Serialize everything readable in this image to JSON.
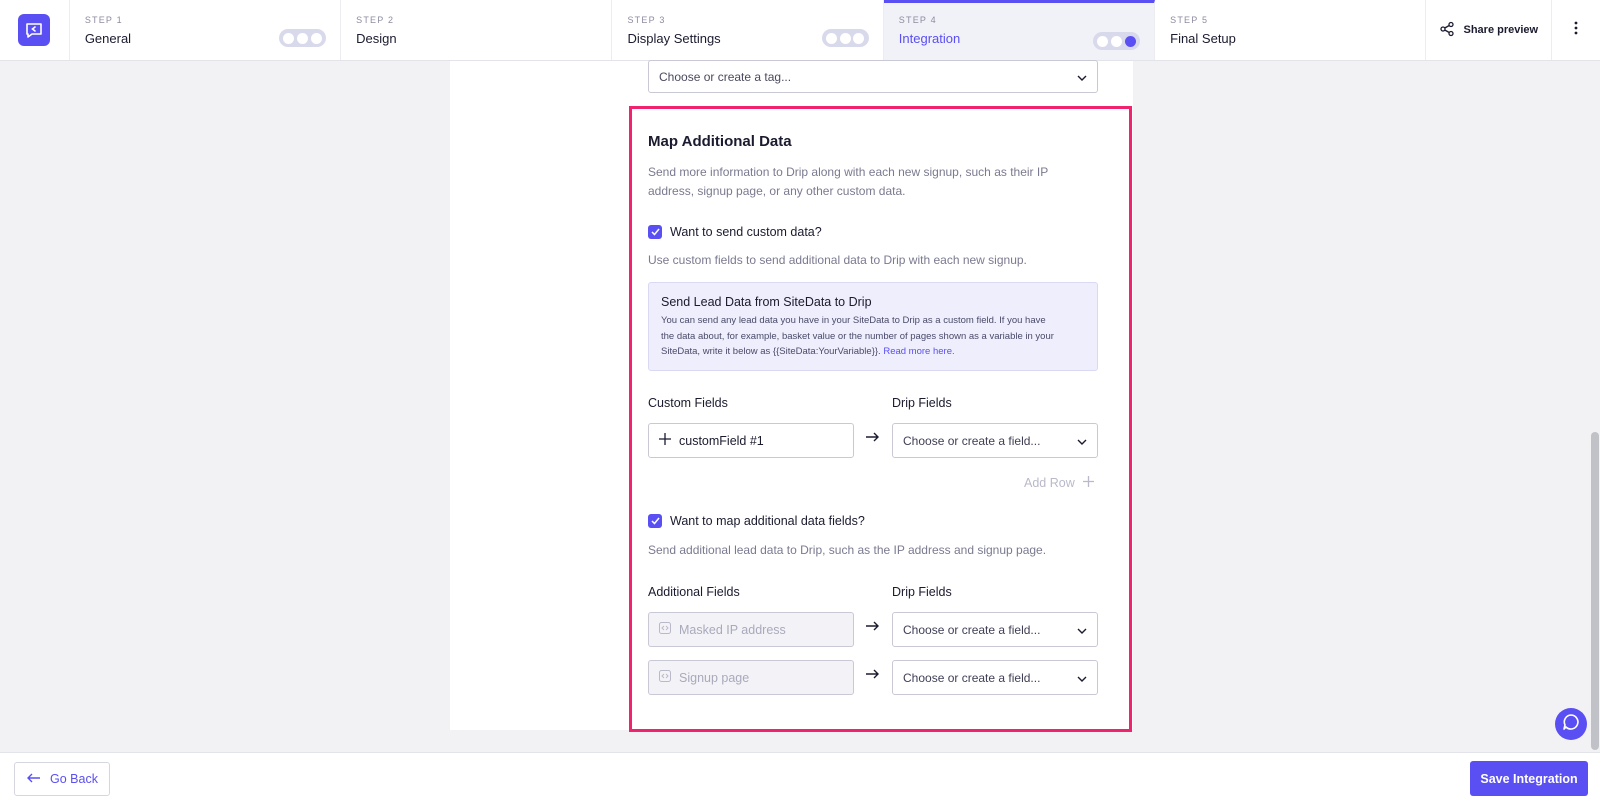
{
  "header": {
    "steps": [
      {
        "num": "STEP 1",
        "name": "General"
      },
      {
        "num": "STEP 2",
        "name": "Design"
      },
      {
        "num": "STEP 3",
        "name": "Display Settings"
      },
      {
        "num": "STEP 4",
        "name": "Integration"
      },
      {
        "num": "STEP 5",
        "name": "Final Setup"
      }
    ],
    "share_label": "Share preview"
  },
  "tag_select": {
    "placeholder": "Choose or create a tag..."
  },
  "map_section": {
    "title": "Map Additional Data",
    "description_line1": "Send more information to Drip along with each new signup, such as their IP",
    "description_line2": "address, signup page, or any other custom data.",
    "custom_checkbox_label": "Want to send custom data?",
    "custom_help": "Use custom fields to send additional data to Drip with each new signup.",
    "info_title": "Send Lead Data from SiteData to Drip",
    "info_line1": "You can send any lead data you have in your SiteData to Drip as a custom field. If you have",
    "info_line2": "the data about, for example, basket value or the number of pages shown as a variable in your",
    "info_line3": "SiteData, write it below as {{SiteData:YourVariable}}.",
    "info_link": "Read more here.",
    "custom_fields_label": "Custom Fields",
    "drip_fields_label": "Drip Fields",
    "custom_field_value": "customField #1",
    "drip_select_placeholder": "Choose or create a field...",
    "add_row_label": "Add Row",
    "additional_checkbox_label": "Want to map additional data fields?",
    "additional_help": "Send additional lead data to Drip, such as the IP address and signup page.",
    "additional_fields_label": "Additional Fields",
    "additional_rows": [
      {
        "field": "Masked IP address",
        "select": "Choose or create a field..."
      },
      {
        "field": "Signup page",
        "select": "Choose or create a field..."
      }
    ]
  },
  "footer": {
    "back_label": "Go Back",
    "save_label": "Save Integration"
  }
}
